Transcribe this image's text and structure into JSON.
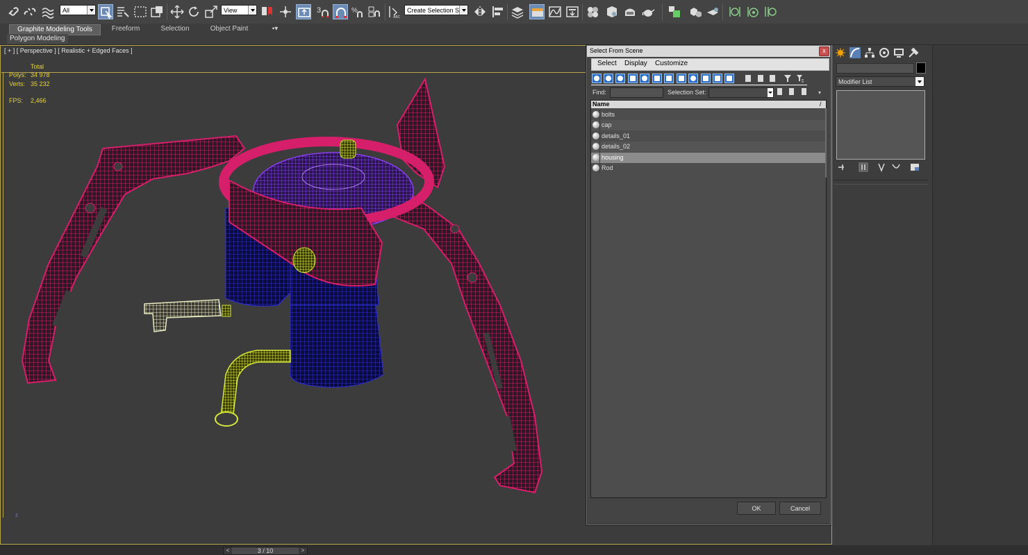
{
  "toolbar": {
    "selection_filter": "All",
    "reference_coord": "View",
    "snap_angle_label": "3",
    "named_selection_placeholder": "Create Selection Se",
    "icons": [
      "select-and-link-icon",
      "unlink-icon",
      "bind-space-warp-icon",
      "select-object-icon",
      "select-by-name-icon",
      "rectangular-selection-icon",
      "window-crossing-icon",
      "move-icon",
      "rotate-icon",
      "scale-icon",
      "pivot-center-icon",
      "select-manipulate-icon",
      "keyboard-shortcut-icon",
      "snaps-toggle-icon",
      "angle-snap-icon",
      "percent-snap-icon",
      "spinner-snap-icon",
      "edit-named-selection-icon",
      "mirror-icon",
      "align-icon",
      "layer-manager-icon",
      "graphite-toggle-icon",
      "curve-editor-icon",
      "schematic-view-icon",
      "material-editor-icon",
      "render-setup-icon",
      "rendered-frame-icon",
      "render-icon",
      "render-teapot-icon"
    ]
  },
  "ribbon": {
    "tabs": [
      "Graphite Modeling Tools",
      "Freeform",
      "Selection",
      "Object Paint"
    ],
    "active_tab": "Graphite Modeling Tools",
    "panel": "Polygon Modeling"
  },
  "viewport": {
    "label": "[ + ] [ Perspective ] [ Realistic + Edged Faces ]",
    "stats": {
      "total_label": "Total",
      "polys_label": "Polys:",
      "polys_value": "34 978",
      "verts_label": "Verts:",
      "verts_value": "35 232",
      "fps_label": "FPS:",
      "fps_value": "2,466"
    },
    "axis_label": "z",
    "colors": {
      "legs": "#d61f6b",
      "body": "#2626c9",
      "top": "#8a2be2",
      "parts": "#d6e83a",
      "bracket": "#e8eac0"
    }
  },
  "dialog": {
    "title": "Select From Scene",
    "close_label": "x",
    "menu": [
      "Select",
      "Display",
      "Customize"
    ],
    "find_label": "Find:",
    "selection_set_label": "Selection Set:",
    "column_header": "Name",
    "sort_indicator": "/",
    "items": [
      {
        "name": "bolts",
        "selected": false
      },
      {
        "name": "cap",
        "selected": false
      },
      {
        "name": "details_01",
        "selected": false
      },
      {
        "name": "details_02",
        "selected": false
      },
      {
        "name": "housing",
        "selected": true
      },
      {
        "name": "Rod",
        "selected": false
      }
    ],
    "ok_label": "OK",
    "cancel_label": "Cancel"
  },
  "command_panel": {
    "tabs": [
      "create-icon",
      "modify-icon",
      "hierarchy-icon",
      "motion-icon",
      "display-icon",
      "utilities-icon"
    ],
    "modifier_list": "Modifier List"
  },
  "timeline": {
    "frame": "3 / 10",
    "prev": "<",
    "next": ">"
  }
}
